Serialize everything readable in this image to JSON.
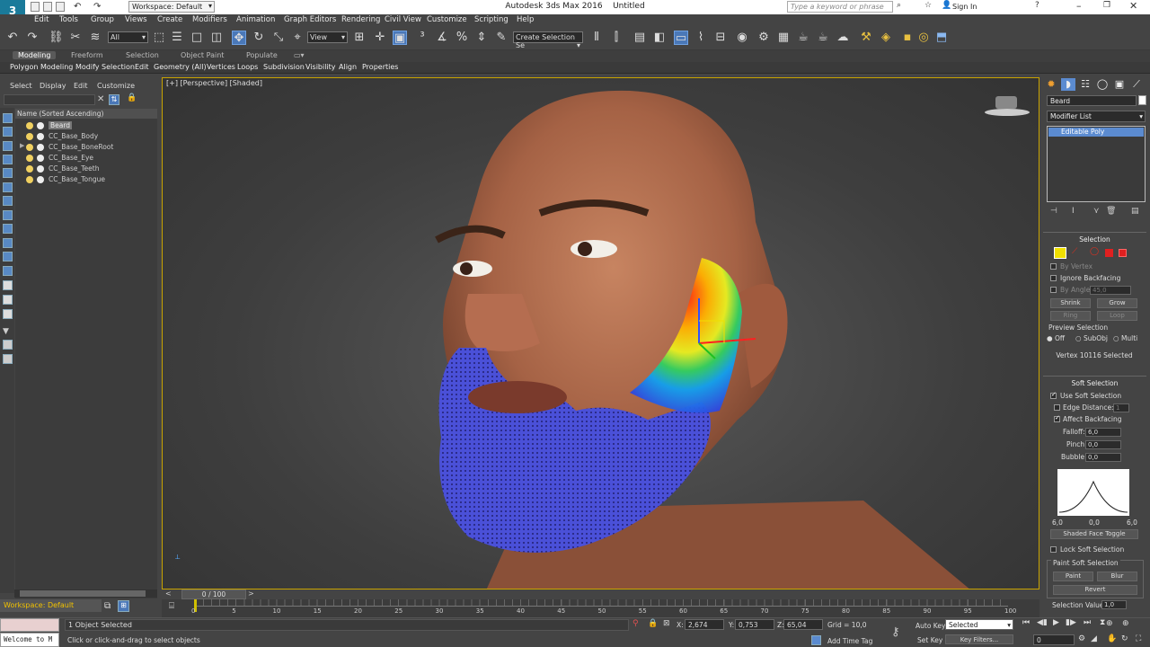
{
  "title_bar": {
    "app_title": "Autodesk 3ds Max 2016",
    "document": "Untitled",
    "workspace": "Workspace: Default",
    "search_placeholder": "Type a keyword or phrase",
    "sign_in": "Sign In"
  },
  "menu": [
    "Edit",
    "Tools",
    "Group",
    "Views",
    "Create",
    "Modifiers",
    "Animation",
    "Graph Editors",
    "Rendering",
    "Civil View",
    "Customize",
    "Scripting",
    "Help"
  ],
  "toolbar": {
    "selection_filter": "All",
    "ref_coord": "View",
    "named_selection": "Create Selection Se"
  },
  "ribbon": {
    "tabs": [
      "Modeling",
      "Freeform",
      "Selection",
      "Object Paint",
      "Populate"
    ],
    "active_tab": "Modeling",
    "items": [
      "Polygon Modeling",
      "Modify Selection",
      "Edit",
      "Geometry (All)",
      "Vertices",
      "Loops",
      "Subdivision",
      "Visibility",
      "Align",
      "Properties"
    ]
  },
  "scene_explorer": {
    "menu": [
      "Select",
      "Display",
      "Edit",
      "Customize"
    ],
    "column_header": "Name (Sorted Ascending)",
    "rows": [
      "Beard",
      "CC_Base_Body",
      "CC_Base_BoneRoot",
      "CC_Base_Eye",
      "CC_Base_Teeth",
      "CC_Base_Tongue"
    ],
    "selected": "Beard",
    "workspace_footer": "Workspace: Default"
  },
  "viewport": {
    "label": "[+] [Perspective] [Shaded]"
  },
  "command_panel": {
    "object_name": "Beard",
    "modifier_list": "Modifier List",
    "stack_item": "Editable Poly",
    "selection": {
      "header": "Selection",
      "by_vertex": "By Vertex",
      "ignore_backfacing": "Ignore Backfacing",
      "by_angle": "By Angle:",
      "by_angle_value": "45,0",
      "shrink": "Shrink",
      "grow": "Grow",
      "ring": "Ring",
      "loop": "Loop",
      "preview_selection": "Preview Selection",
      "preview_options": [
        "Off",
        "SubObj",
        "Multi"
      ],
      "status": "Vertex 10116 Selected"
    },
    "soft_selection": {
      "header": "Soft Selection",
      "use_soft": "Use Soft Selection",
      "edge_distance": "Edge Distance:",
      "edge_distance_value": "1",
      "affect_backfacing": "Affect Backfacing",
      "falloff_label": "Falloff:",
      "falloff": "6,0",
      "pinch_label": "Pinch:",
      "pinch": "0,0",
      "bubble_label": "Bubble:",
      "bubble": "0,0",
      "curve_labels": [
        "6,0",
        "0,0",
        "6,0"
      ],
      "shaded_face_toggle": "Shaded Face Toggle",
      "lock_soft": "Lock Soft Selection",
      "paint_header": "Paint Soft Selection",
      "paint": "Paint",
      "blur": "Blur",
      "revert": "Revert",
      "selection_value_label": "Selection Value",
      "selection_value": "1,0"
    }
  },
  "timeline": {
    "frame": "0 / 100",
    "ticks": [
      "0",
      "5",
      "10",
      "15",
      "20",
      "25",
      "30",
      "35",
      "40",
      "45",
      "50",
      "55",
      "60",
      "65",
      "70",
      "75",
      "80",
      "85",
      "90",
      "95",
      "100"
    ]
  },
  "status": {
    "maxscript": "Welcome to M",
    "objects_selected": "1 Object Selected",
    "prompt": "Click or click-and-drag to select objects",
    "x_label": "X:",
    "x": "2,674",
    "y_label": "Y:",
    "y": "0,753",
    "z_label": "Z:",
    "z": "65,04",
    "grid": "Grid = 10,0",
    "add_time_tag": "Add Time Tag",
    "auto_key": "Auto Key",
    "set_key": "Set Key",
    "key_mode": "Selected",
    "key_filters": "Key Filters...",
    "current_frame": "0"
  }
}
